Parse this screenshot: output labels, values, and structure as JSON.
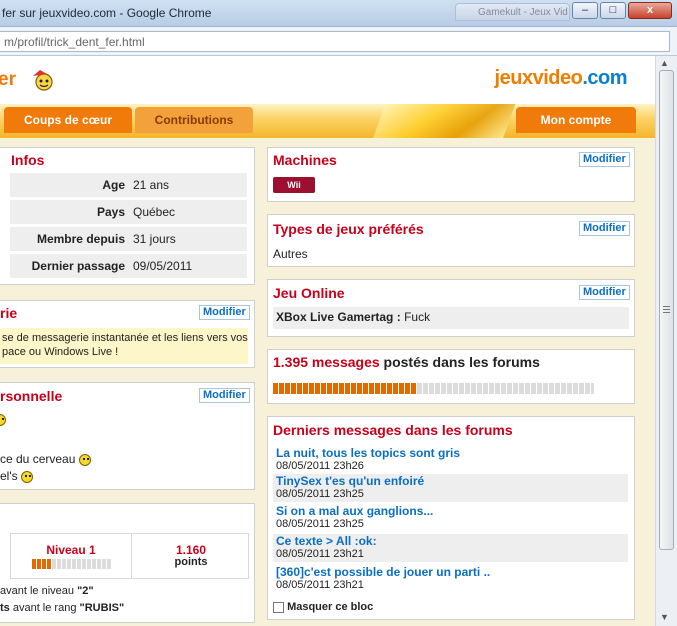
{
  "window": {
    "title": "fer sur jeuxvideo.com - Google Chrome",
    "background_tab_title": "Gamekult - Jeux Vid",
    "minimize": "–",
    "maximize": "□",
    "close": "x"
  },
  "address_bar": {
    "url": "m/profil/trick_dent_fer.html"
  },
  "header": {
    "left_text": "er",
    "logo_part1": "jeuxvideo",
    "logo_part2": ".com"
  },
  "nav": {
    "tabs": [
      "Coups de cœur",
      "Contributions",
      "Mon compte"
    ]
  },
  "infos": {
    "title": "Infos",
    "rows": [
      {
        "label": "Age",
        "value": "21 ans"
      },
      {
        "label": "Pays",
        "value": "Québec"
      },
      {
        "label": "Membre depuis",
        "value": "31 jours"
      },
      {
        "label": "Dernier passage",
        "value": "09/05/2011"
      }
    ]
  },
  "messagerie": {
    "title": "rie",
    "modify": "Modifier",
    "text_line1": "se de messagerie instantanée et les liens vers vos",
    "text_line2": "pace ou Windows Live !"
  },
  "personnelle": {
    "title": "rsonnelle",
    "modify": "Modifier",
    "line1": "ce du cerveau",
    "line2": "el's"
  },
  "niveau": {
    "label": "Niveau 1",
    "points_value": "1.160",
    "points_label": "points",
    "line1_prefix": "avant le niveau",
    "line1_value": "\"2\"",
    "line2_bold": "ts",
    "line2_mid": "avant le rang",
    "line2_value": "\"RUBIS\""
  },
  "machines": {
    "title": "Machines",
    "modify": "Modifier",
    "badge": "Wii"
  },
  "types": {
    "title": "Types de jeux préférés",
    "modify": "Modifier",
    "value": "Autres"
  },
  "online": {
    "title": "Jeu Online",
    "modify": "Modifier",
    "label": "XBox Live Gamertag :",
    "value": "Fuck"
  },
  "forum_stats": {
    "count": "1.395 messages",
    "suffix": "postés dans les forums",
    "progress": 0.45
  },
  "derniers": {
    "title": "Derniers messages dans les forums",
    "messages": [
      {
        "title": "La nuit, tous les topics sont gris",
        "date": "08/05/2011 23h26"
      },
      {
        "title": "TinySex t'es qu'un enfoiré",
        "date": "08/05/2011 23h25"
      },
      {
        "title": "Si on a mal aux ganglions...",
        "date": "08/05/2011 23h25"
      },
      {
        "title": "Ce texte > All :ok:",
        "date": "08/05/2011 23h21"
      },
      {
        "title": "[360]c'est possible de jouer un parti ..",
        "date": "08/05/2011 23h21"
      }
    ],
    "hide_label": "Masquer ce bloc"
  },
  "colors": {
    "accent_orange": "#f07b0a",
    "title_red": "#c8001a",
    "link_blue": "#0a6ec2",
    "wii_badge": "#9b1030"
  }
}
